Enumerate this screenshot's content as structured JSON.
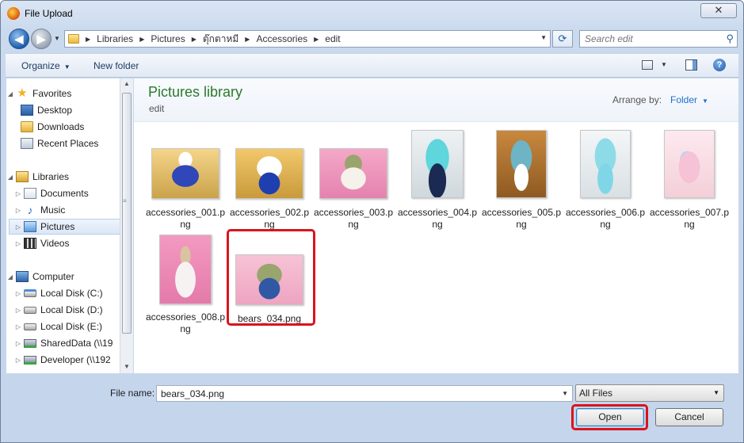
{
  "window": {
    "title": "File Upload",
    "close_glyph": "✕"
  },
  "address": {
    "crumbs": [
      "Libraries",
      "Pictures",
      "ตุ๊กตาหมี",
      "Accessories",
      "edit"
    ],
    "search_placeholder": "Search edit"
  },
  "toolbar": {
    "organize": "Organize",
    "new_folder": "New folder"
  },
  "nav": {
    "items": [
      {
        "label": "Favorites",
        "icon": "star-icon"
      },
      {
        "label": "Desktop",
        "icon": "desktop-icon"
      },
      {
        "label": "Downloads",
        "icon": "downloads-folder-icon"
      },
      {
        "label": "Recent Places",
        "icon": "recent-places-icon"
      },
      {
        "label": "Libraries",
        "icon": "libraries-icon"
      },
      {
        "label": "Documents",
        "icon": "documents-icon"
      },
      {
        "label": "Music",
        "icon": "music-icon"
      },
      {
        "label": "Pictures",
        "icon": "pictures-icon"
      },
      {
        "label": "Videos",
        "icon": "videos-icon"
      },
      {
        "label": "Computer",
        "icon": "computer-icon"
      },
      {
        "label": "Local Disk (C:)",
        "icon": "system-disk-icon"
      },
      {
        "label": "Local Disk (D:)",
        "icon": "disk-icon"
      },
      {
        "label": "Local Disk (E:)",
        "icon": "disk-icon"
      },
      {
        "label": "SharedData (\\\\19",
        "icon": "network-drive-icon"
      },
      {
        "label": "Developer (\\\\192",
        "icon": "network-drive-icon"
      }
    ]
  },
  "content": {
    "title": "Pictures library",
    "subtitle": "edit",
    "arrange_label": "Arrange by:",
    "arrange_value": "Folder",
    "files": [
      "accessories_001.png",
      "accessories_002.png",
      "accessories_003.png",
      "accessories_004.png",
      "accessories_005.png",
      "accessories_006.png",
      "accessories_007.png",
      "accessories_008.png",
      "bears_034.png"
    ],
    "selected_file": "bears_034.png"
  },
  "footer": {
    "file_name_label": "File name:",
    "file_name_value": "bears_034.png",
    "file_type": "All Files",
    "open_label": "Open",
    "cancel_label": "Cancel"
  },
  "colors": {
    "library_title": "#2b7a2b",
    "link_blue": "#1f6fcf",
    "highlight_red": "#d9141d"
  }
}
